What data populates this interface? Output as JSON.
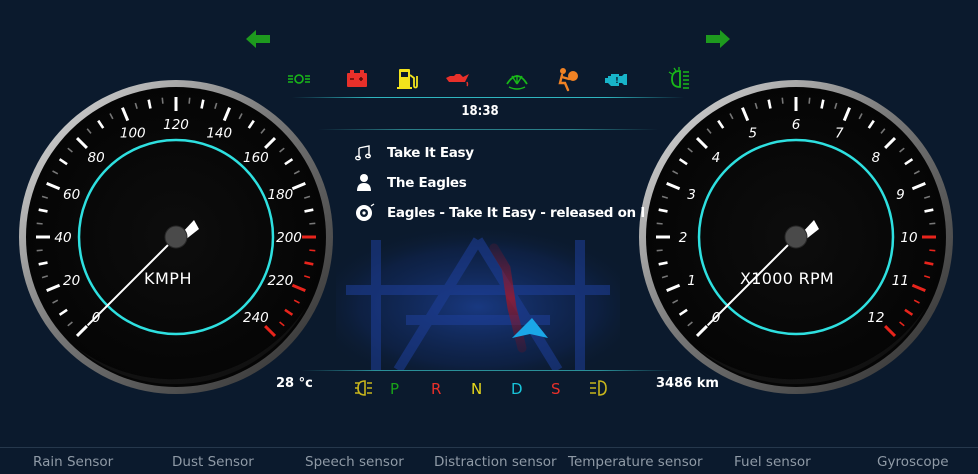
{
  "speedometer": {
    "unit_label": "KMPH",
    "tick_labels": [
      "0",
      "20",
      "40",
      "60",
      "80",
      "100",
      "120",
      "140",
      "160",
      "180",
      "200",
      "220",
      "240"
    ],
    "needle_value": 0
  },
  "tachometer": {
    "unit_label": "X1000 RPM",
    "tick_labels": [
      "0",
      "1",
      "2",
      "3",
      "4",
      "5",
      "6",
      "7",
      "8",
      "9",
      "10",
      "11",
      "12"
    ],
    "needle_value": 0
  },
  "indicators": {
    "left_turn": "left-turn-arrow-icon",
    "right_turn": "right-turn-arrow-icon",
    "warnings": [
      {
        "name": "parking-lights-icon",
        "color": "#19b819"
      },
      {
        "name": "battery-warning-icon",
        "color": "#e8302a"
      },
      {
        "name": "fuel-icon",
        "color": "#f2e31c"
      },
      {
        "name": "oil-pressure-icon",
        "color": "#e8302a"
      },
      {
        "name": "washer-fluid-icon",
        "color": "#19b819"
      },
      {
        "name": "airbag-icon",
        "color": "#f08224"
      },
      {
        "name": "engine-check-icon",
        "color": "#18b4c9"
      },
      {
        "name": "headlight-icon",
        "color": "#19b819"
      }
    ]
  },
  "clock": {
    "time": "18:38"
  },
  "media": {
    "song": "Take It Easy",
    "artist": "The Eagles",
    "info": "Eagles - Take It Easy - released on I"
  },
  "status": {
    "temperature": "28 °c",
    "odometer": "3486 km"
  },
  "gears": [
    {
      "label": "P",
      "color": "#19a319"
    },
    {
      "label": "R",
      "color": "#e8302a"
    },
    {
      "label": "N",
      "color": "#e8d81c"
    },
    {
      "label": "D",
      "color": "#18c4d9"
    },
    {
      "label": "S",
      "color": "#e8302a"
    }
  ],
  "sensors": [
    "Rain Sensor",
    "Dust Sensor",
    "Speech sensor",
    "Distraction sensor",
    "Temperature sensor",
    "Fuel sensor",
    "Gyroscope"
  ],
  "colors": {
    "background": "#0b1a2d",
    "accent_cyan": "#2ee0e0",
    "redline": "#e8241c"
  }
}
